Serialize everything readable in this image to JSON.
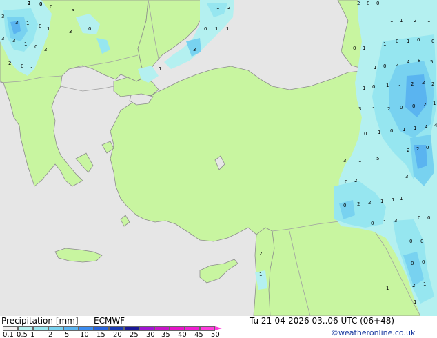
{
  "footer": {
    "title": "Precipitation [mm]",
    "model": "ECMWF",
    "datetime": "Tu 21-04-2026 03..06 UTC (06+48)",
    "credit": "©weatheronline.co.uk"
  },
  "legend": {
    "labels": [
      "0.1",
      "0.5",
      "1",
      "2",
      "5",
      "10",
      "15",
      "20",
      "25",
      "30",
      "35",
      "40",
      "45",
      "50"
    ],
    "colors": [
      "#f0f0f0",
      "#b4f0f0",
      "#96e6f0",
      "#78d2f0",
      "#5ab4f0",
      "#3c8cf0",
      "#2864dc",
      "#1a3cb4",
      "#1a1896",
      "#a014d2",
      "#c814c8",
      "#e614c8",
      "#f01ed2",
      "#ff3cdc"
    ]
  },
  "map": {
    "colors": {
      "sea": "#e6e6e6",
      "land": "#c8f5a0",
      "border": "#a0a0a0",
      "coast": "#8c8c8c"
    },
    "values": [
      "1",
      "0",
      "0",
      "3",
      "3",
      "1",
      "0",
      "1",
      "3",
      "3",
      "1",
      "0",
      "2",
      "2",
      "0",
      "1",
      "3",
      "3",
      "0",
      "1",
      "2",
      "0",
      "1",
      "1",
      "3",
      "1",
      "2",
      "8",
      "0",
      "1",
      "1",
      "2",
      "1",
      "1",
      "0",
      "1",
      "0",
      "0",
      "0",
      "1",
      "1",
      "0",
      "2",
      "4",
      "8",
      "5",
      "1",
      "0",
      "1",
      "1",
      "2",
      "2",
      "2",
      "3",
      "1",
      "2",
      "0",
      "0",
      "2",
      "1",
      "0",
      "1",
      "0",
      "1",
      "1",
      "4",
      "4",
      "2",
      "2",
      "0",
      "3",
      "1",
      "5",
      "3",
      "0",
      "2",
      "0",
      "2",
      "2",
      "1",
      "1",
      "1",
      "0",
      "0",
      "1",
      "0",
      "1",
      "3",
      "0",
      "0",
      "0",
      "0",
      "2",
      "1",
      "2",
      "1",
      "1",
      "1",
      "2",
      "0"
    ]
  }
}
